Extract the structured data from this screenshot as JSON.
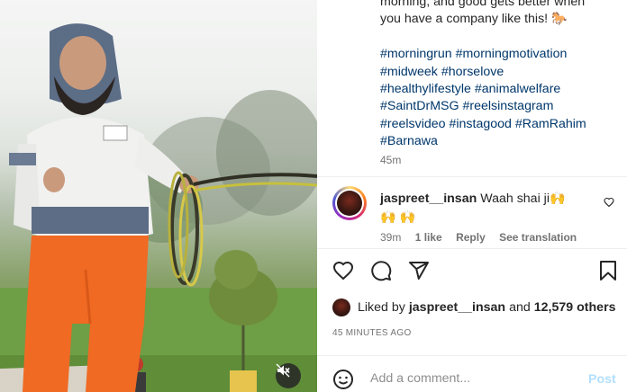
{
  "media": {
    "description_icon": "video-frame",
    "mute_icon": "speaker-muted-icon"
  },
  "caption": {
    "lines": [
      "morning, and good gets better when",
      "you have a company like this! 🐎"
    ],
    "hashtag_lines": [
      "#morningrun #morningmotivation",
      "#midweek #horselove",
      "#healthylifestyle #animalwelfare",
      "#SaintDrMSG #reelsinstagram",
      "#reelsvideo #instagood #RamRahim",
      "#Barnawa"
    ],
    "time": "45m"
  },
  "comment": {
    "username": "jaspreet__insan",
    "text": "Waah shai ji🙌 🙌 🙌",
    "time": "39m",
    "likes": "1 like",
    "reply_label": "Reply",
    "translate_label": "See translation"
  },
  "liked_by": {
    "prefix": "Liked by",
    "username": "jaspreet__insan",
    "middle": "and",
    "count": "12,579 others"
  },
  "post_time": "45 MINUTES AGO",
  "add_comment": {
    "placeholder": "Add a comment...",
    "post_label": "Post"
  },
  "colors": {
    "hashtag": "#00376b",
    "post_button_disabled": "#b2dffc",
    "secondary_text": "#737373"
  }
}
